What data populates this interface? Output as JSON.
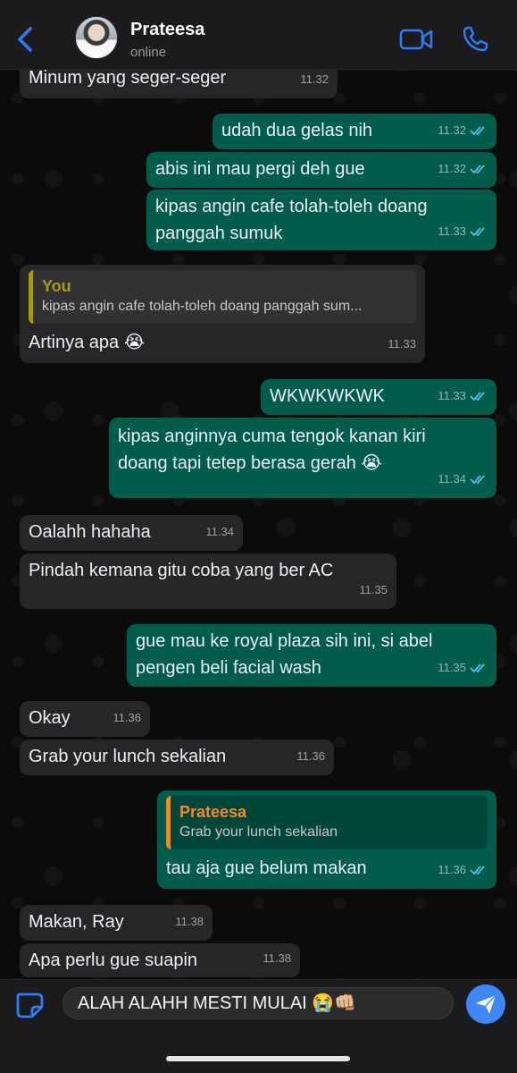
{
  "header": {
    "contact_name": "Prateesa",
    "status": "online",
    "back_icon": "chevron-left-icon",
    "video_icon": "video-camera-icon",
    "call_icon": "phone-icon",
    "accent_color": "#2f7cf6"
  },
  "messages": [
    {
      "dir": "in",
      "text": "Minum yang seger-seger",
      "time": "11.32"
    },
    {
      "dir": "out",
      "text": "udah dua gelas nih",
      "time": "11.32",
      "read": true
    },
    {
      "dir": "out",
      "text": "abis ini mau pergi deh gue",
      "time": "11.32",
      "read": true
    },
    {
      "dir": "out",
      "text": "kipas angin cafe tolah-toleh doang\npanggah sumuk",
      "time": "11.33",
      "read": true
    },
    {
      "dir": "in",
      "quote_name": "You",
      "quote_text": "kipas angin cafe tolah-toleh doang panggah sum...",
      "text": "Artinya apa 😭",
      "time": "11.33"
    },
    {
      "dir": "out",
      "text": "WKWKWKWK",
      "time": "11.33",
      "read": true
    },
    {
      "dir": "out",
      "text": "kipas anginnya cuma tengok kanan kiri\ndoang tapi tetep berasa gerah 😭",
      "time": "11.34",
      "read": true
    },
    {
      "dir": "in",
      "text": "Oalahh hahaha",
      "time": "11.34"
    },
    {
      "dir": "in",
      "text": "Pindah kemana gitu coba yang ber AC",
      "time": "11.35"
    },
    {
      "dir": "out",
      "text": "gue mau ke royal plaza sih ini, si abel\npengen beli facial wash",
      "time": "11.35",
      "read": true
    },
    {
      "dir": "in",
      "text": "Okay",
      "time": "11.36"
    },
    {
      "dir": "in",
      "text": "Grab your lunch sekalian",
      "time": "11.36"
    },
    {
      "dir": "out",
      "quote_name": "Prateesa",
      "quote_text": "Grab your lunch sekalian",
      "text": "tau aja gue belum makan",
      "time": "11.36",
      "read": true
    },
    {
      "dir": "in",
      "text": "Makan, Ray",
      "time": "11.38"
    },
    {
      "dir": "in",
      "text": "Apa perlu gue suapin",
      "time": "11.38"
    }
  ],
  "composer": {
    "text": "ALAH ALAHH MESTI MULAI 😭👊🏼",
    "attach_icon": "sticker-icon",
    "send_icon": "send-arrow-icon",
    "send_color": "#3f86f7"
  },
  "colors": {
    "incoming_bubble": "#262628",
    "outgoing_bubble": "#005c4b",
    "read_ticks": "#53bdeb",
    "quote_bar_outgoing": "#f08a2a",
    "quote_bar_incoming": "#a79b10"
  }
}
